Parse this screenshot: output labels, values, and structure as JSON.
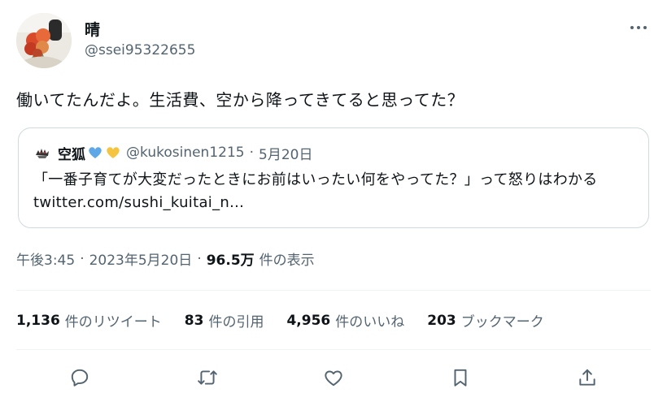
{
  "author": {
    "display_name": "晴",
    "handle": "@ssei95322655",
    "avatar": "flower-bouquet-photo"
  },
  "tweet": {
    "text": "働いてたんだよ。生活費、空から降ってきてると思ってた？"
  },
  "quote": {
    "name": "空狐",
    "name_icons": [
      "blue-heart",
      "yellow-heart"
    ],
    "handle": "@kukosinen1215",
    "separator": "·",
    "date": "5月20日",
    "text": "「一番子育てが大変だったときにお前はいったい何をやってた？」って怒りはわかる ",
    "link": "twitter.com/sushi_kuitai_n..."
  },
  "meta": {
    "time": "午後3:45",
    "dot1": "·",
    "date": "2023年5月20日",
    "dot2": "·",
    "views": "96.5万",
    "views_label": "件の表示"
  },
  "stats": {
    "retweets": {
      "count": "1,136",
      "label": "件のリツイート"
    },
    "quotes": {
      "count": "83",
      "label": "件の引用"
    },
    "likes": {
      "count": "4,956",
      "label": "件のいいね"
    },
    "bookmarks": {
      "count": "203",
      "label": "ブックマーク"
    }
  },
  "actions": [
    "reply-icon",
    "retweet-icon",
    "like-icon",
    "bookmark-icon",
    "share-icon"
  ],
  "colors": {
    "text": "#0f1419",
    "secondary": "#536471",
    "border": "#cfd9de",
    "blue_heart": "#5fa8e8",
    "yellow_heart": "#f5c542"
  }
}
